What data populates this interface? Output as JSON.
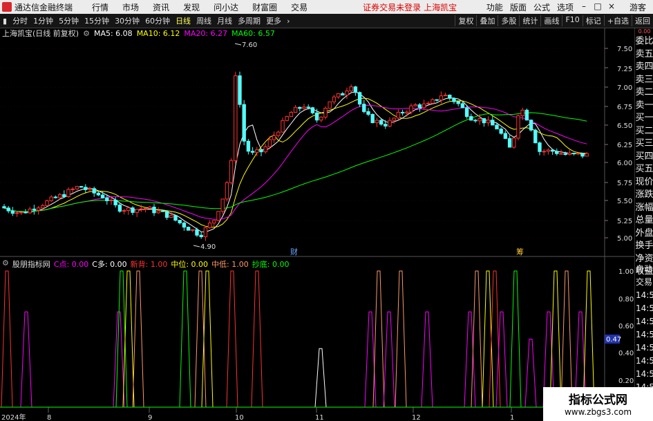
{
  "menubar": {
    "app_title": "通达信金融终端",
    "items": [
      "行情",
      "市场",
      "资讯",
      "发现",
      "问小达",
      "财富圈",
      "交易"
    ],
    "warning": "证券交易未登录",
    "stock": "上海凯宝",
    "right_items": [
      "功能",
      "版面",
      "公式",
      "选项"
    ],
    "guest": "游客"
  },
  "toolbar": {
    "periods": [
      "分时",
      "1分钟",
      "5分钟",
      "15分钟",
      "30分钟",
      "60分钟",
      "日线",
      "周线",
      "月线",
      "多周期",
      "更多"
    ],
    "active": "日线",
    "right_buttons": [
      "复权",
      "叠加",
      "多股",
      "统计",
      "画线",
      "F10",
      "标记",
      "+自选",
      "返回"
    ]
  },
  "title": {
    "name": "上海凯宝(日线 前复权)",
    "ma5": "MA5: 6.08",
    "ma10": "MA10: 6.12",
    "ma20": "MA20: 6.27",
    "ma60": "MA60: 6.57"
  },
  "colors": {
    "up": "#ff3232",
    "down": "#54fcfc",
    "ma5": "#ffffff",
    "ma10": "#ffff00",
    "ma20": "#ff00ff",
    "ma60": "#00ff00"
  },
  "price_axis": [
    "7.50",
    "7.25",
    "7.00",
    "6.75",
    "6.50",
    "6.25",
    "6.00",
    "5.75",
    "5.50",
    "5.25",
    "5.00"
  ],
  "annotations": {
    "high": "7.60",
    "low": "4.90",
    "cai": "财",
    "chou": "筹"
  },
  "side_labels": [
    "委比",
    "卖五",
    "卖四",
    "卖三",
    "卖二",
    "卖一",
    "买一",
    "买二",
    "买三",
    "买四",
    "买五",
    "现价",
    "涨跌",
    "涨幅",
    "总量",
    "外盘",
    "换手",
    "净资",
    "收益"
  ],
  "side_top": "0.00",
  "indicator": {
    "name": "股朋指标网",
    "c_point": "C点: 0.00",
    "c_duo": "C多: 0.00",
    "xinbei": "新背: 1.00",
    "zhongwei": "中位: 0.00",
    "zhongdi": "中低: 1.00",
    "chaodi": "抄底: 0.00",
    "axis": [
      "1.00",
      "0.80",
      "0.60",
      "0.40",
      "0.20"
    ],
    "current": "0.47"
  },
  "side_ind": [
    "自动",
    "交易",
    "14:56",
    "14:56",
    "14:56",
    "14:56",
    "14:56",
    "14:56",
    "14:56",
    "14:56",
    "14:56"
  ],
  "xaxis": [
    "2024年",
    "8",
    "9",
    "10",
    "11",
    "12",
    "1"
  ],
  "watermark": {
    "title": "指标公式网",
    "url": "www.zbgs3.com"
  }
}
